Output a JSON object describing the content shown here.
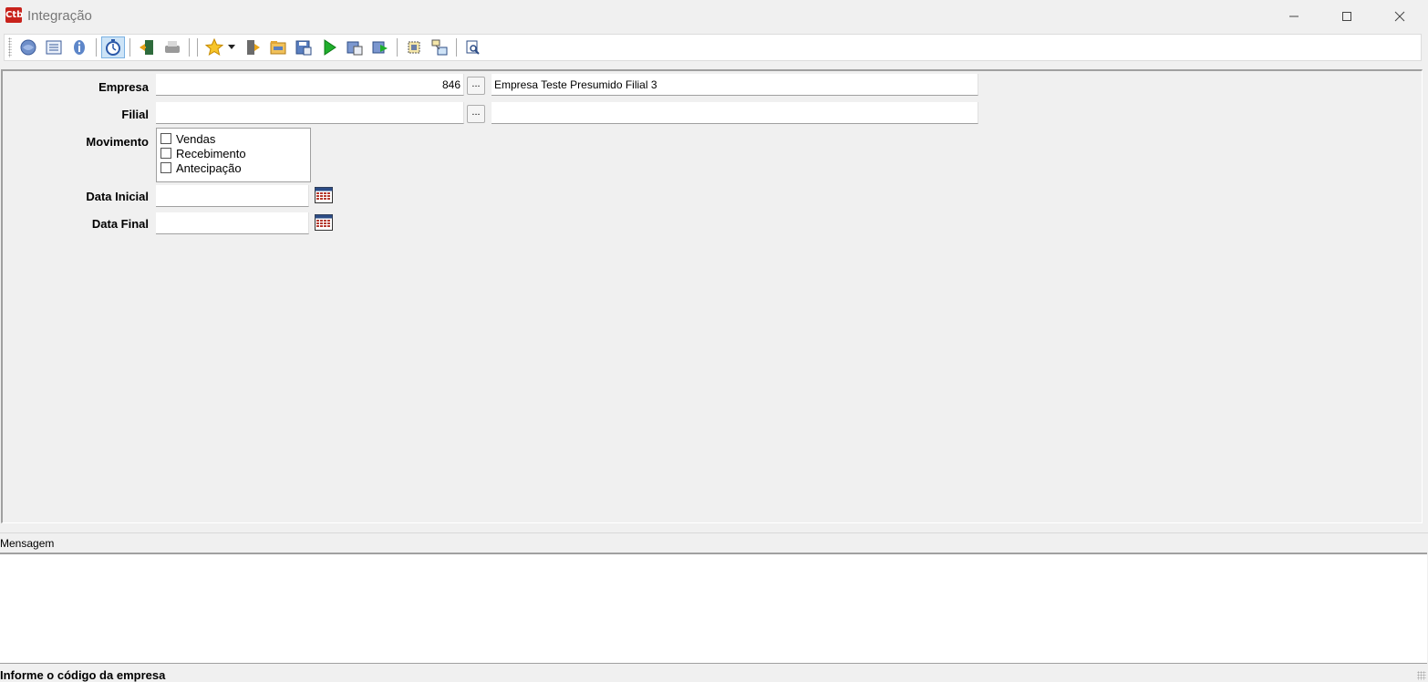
{
  "window": {
    "title": "Integração",
    "app_icon_text": "Ctb"
  },
  "toolbar": {
    "buttons": [
      "help-globe-icon",
      "list-view-icon",
      "info-icon",
      "timer-icon",
      "exit-icon",
      "print-icon",
      "favorites-star-icon",
      "door-exit-icon",
      "folder-icon",
      "save-disk-icon",
      "run-play-icon",
      "import-icon",
      "export-icon",
      "select-area-icon",
      "filter-icon",
      "preview-icon"
    ]
  },
  "form": {
    "empresa_label": "Empresa",
    "empresa_code": "846",
    "empresa_name": "Empresa Teste Presumido Filial 3",
    "filial_label": "Filial",
    "filial_code": "",
    "filial_name": "",
    "lookup_label": "...",
    "movimento_label": "Movimento",
    "movimento_options": [
      {
        "label": "Vendas",
        "checked": false
      },
      {
        "label": "Recebimento",
        "checked": false
      },
      {
        "label": "Antecipação",
        "checked": false
      }
    ],
    "data_inicial_label": "Data Inicial",
    "data_inicial_value": "",
    "data_final_label": "Data Final",
    "data_final_value": ""
  },
  "messages": {
    "header": "Mensagem",
    "content": ""
  },
  "status": {
    "text": "Informe o código da empresa"
  }
}
